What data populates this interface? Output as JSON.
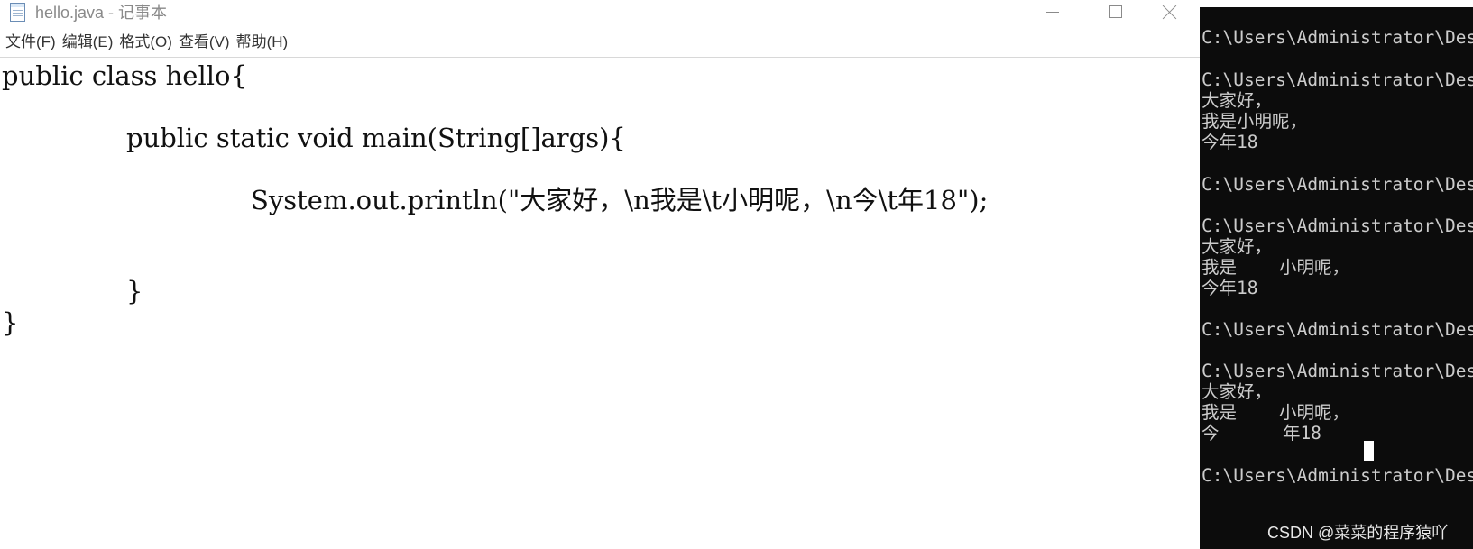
{
  "notepad": {
    "title": "hello.java - 记事本",
    "menu": [
      "文件(F)",
      "编辑(E)",
      "格式(O)",
      "查看(V)",
      "帮助(H)"
    ],
    "code_lines": [
      "public class hello{",
      "public static void main(String[]args){",
      "System.out.println(\"大家好，\\n我是\\t小明呢，\\n今\\t年18\");",
      "}",
      "}"
    ]
  },
  "console": {
    "lines": [
      "C:\\Users\\Administrator\\Des",
      "C:\\Users\\Administrator\\Des",
      "大家好，",
      "我是小明呢，",
      "今年18",
      "C:\\Users\\Administrator\\Des",
      "C:\\Users\\Administrator\\Des",
      "大家好，",
      "我是    小明呢，",
      "今年18",
      "C:\\Users\\Administrator\\Des",
      "C:\\Users\\Administrator\\Des",
      "大家好，",
      "我是    小明呢，",
      "今      年18",
      "C:\\Users\\Administrator\\Des"
    ]
  },
  "watermark": "CSDN @菜菜的程序猿吖"
}
